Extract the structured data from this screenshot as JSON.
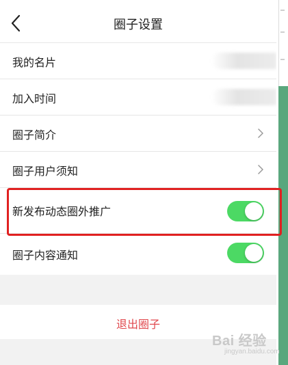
{
  "header": {
    "title": "圈子设置",
    "back_icon": "chevron-left-icon"
  },
  "rows": [
    {
      "label": "我的名片",
      "type": "value",
      "value_blurred": true
    },
    {
      "label": "加入时间",
      "type": "value",
      "value_blurred": true
    },
    {
      "label": "圈子简介",
      "type": "link",
      "icon": "chevron-right-icon"
    },
    {
      "label": "圈子用户须知",
      "type": "link",
      "icon": "chevron-right-icon"
    },
    {
      "label": "新发布动态圈外推广",
      "type": "toggle",
      "on": true
    },
    {
      "label": "圈子内容通知",
      "type": "toggle",
      "on": true
    }
  ],
  "exit": {
    "label": "退出圈子"
  },
  "watermark": {
    "main": "Bai 经验",
    "sub": "jingyan.baidu.com"
  },
  "colors": {
    "toggle_on": "#4cd964",
    "exit_text": "#e0474c",
    "highlight": "#e02020",
    "side_green": "#5aa77d"
  }
}
